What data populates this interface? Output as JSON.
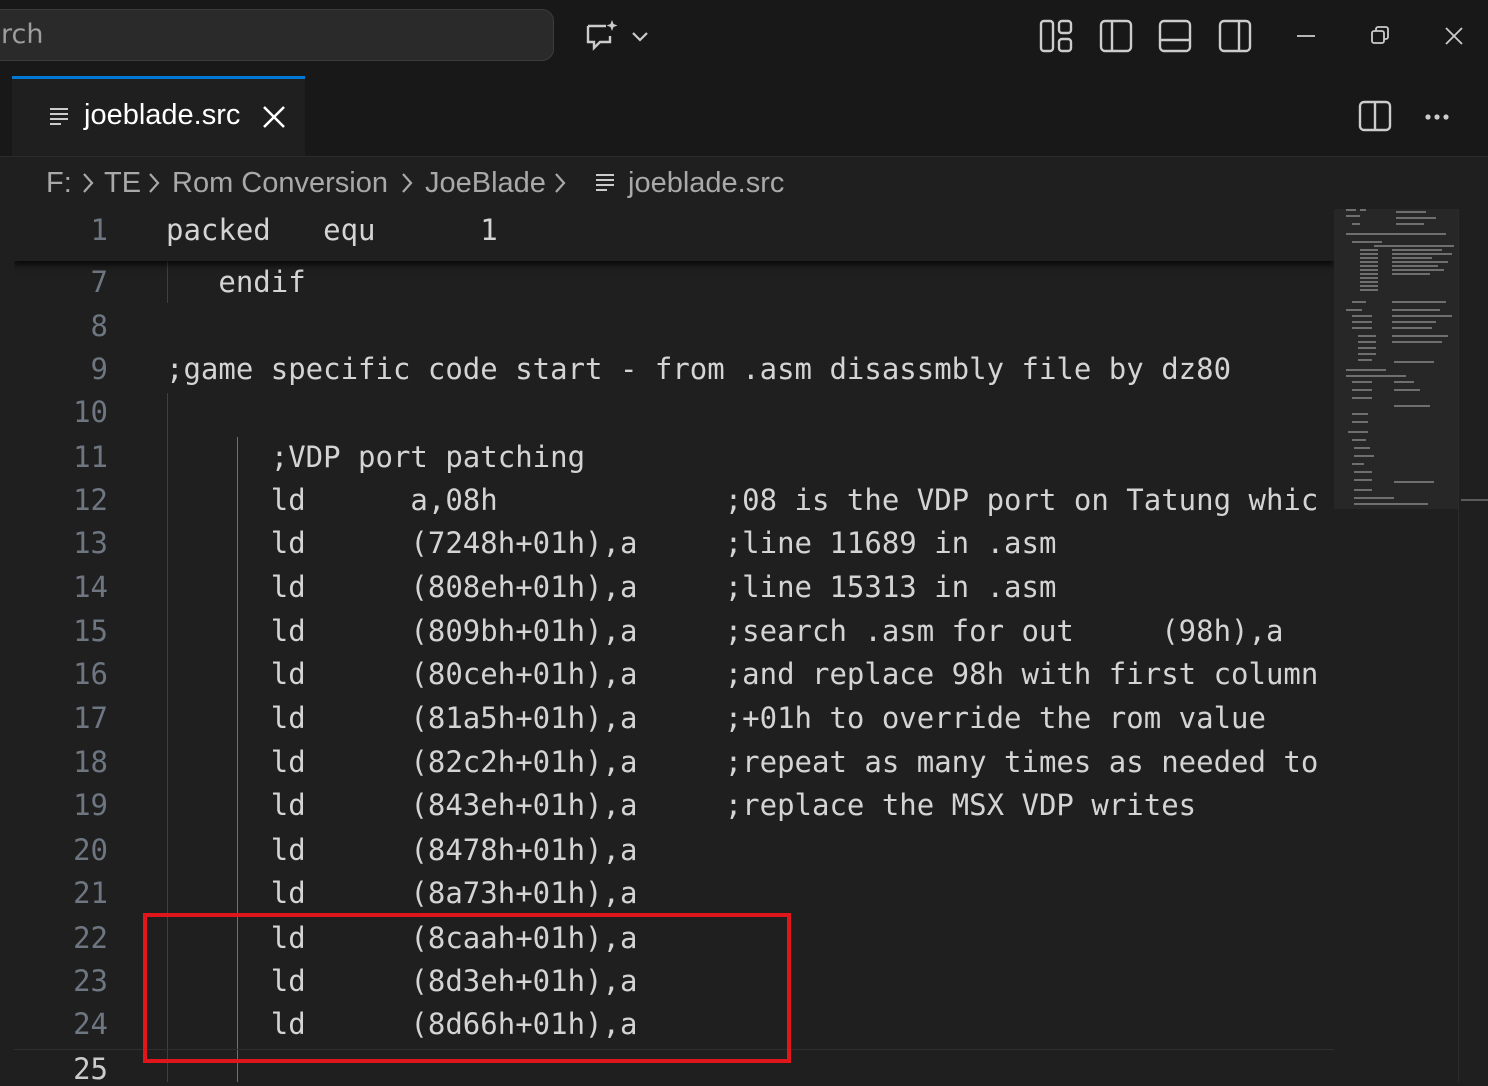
{
  "titlebar": {
    "search_text": "rch",
    "icons": [
      "chat-sparkle-icon",
      "chevron-down-icon",
      "customize-layout-icon",
      "toggle-primary-sidebar-icon",
      "toggle-panel-icon",
      "toggle-secondary-sidebar-icon",
      "minimize-icon",
      "restore-icon",
      "close-icon"
    ]
  },
  "tabs": [
    {
      "label": "joeblade.src",
      "active": true
    }
  ],
  "breadcrumb": [
    "F:",
    "TE",
    "Rom Conversion",
    "JoeBlade",
    "joeblade.src"
  ],
  "editor": {
    "sticky_line": {
      "number": "1",
      "text": "packed   equ      1"
    },
    "lines": [
      {
        "number": "7",
        "text": "   endif"
      },
      {
        "number": "8",
        "text": ""
      },
      {
        "number": "9",
        "text": ";game specific code start - from .asm disassmbly file by dz80"
      },
      {
        "number": "10",
        "text": ""
      },
      {
        "number": "11",
        "text": "      ;VDP port patching"
      },
      {
        "number": "12",
        "text": "      ld      a,08h             ;08 is the VDP port on Tatung whic"
      },
      {
        "number": "13",
        "text": "      ld      (7248h+01h),a     ;line 11689 in .asm"
      },
      {
        "number": "14",
        "text": "      ld      (808eh+01h),a     ;line 15313 in .asm"
      },
      {
        "number": "15",
        "text": "      ld      (809bh+01h),a     ;search .asm for out     (98h),a"
      },
      {
        "number": "16",
        "text": "      ld      (80ceh+01h),a     ;and replace 98h with first column"
      },
      {
        "number": "17",
        "text": "      ld      (81a5h+01h),a     ;+01h to override the rom value"
      },
      {
        "number": "18",
        "text": "      ld      (82c2h+01h),a     ;repeat as many times as needed to"
      },
      {
        "number": "19",
        "text": "      ld      (843eh+01h),a     ;replace the MSX VDP writes"
      },
      {
        "number": "20",
        "text": "      ld      (8478h+01h),a"
      },
      {
        "number": "21",
        "text": "      ld      (8a73h+01h),a"
      },
      {
        "number": "22",
        "text": "      ld      (8caah+01h),a"
      },
      {
        "number": "23",
        "text": "      ld      (8d3eh+01h),a"
      },
      {
        "number": "24",
        "text": "      ld      (8d66h+01h),a"
      },
      {
        "number": "25",
        "text": ""
      }
    ]
  },
  "editor_actions": {
    "icons": [
      "split-editor-icon",
      "more-actions-icon"
    ]
  },
  "colors": {
    "accent": "#0078d4",
    "highlight_box": "#e0161b",
    "background": "#1f1f1f"
  }
}
